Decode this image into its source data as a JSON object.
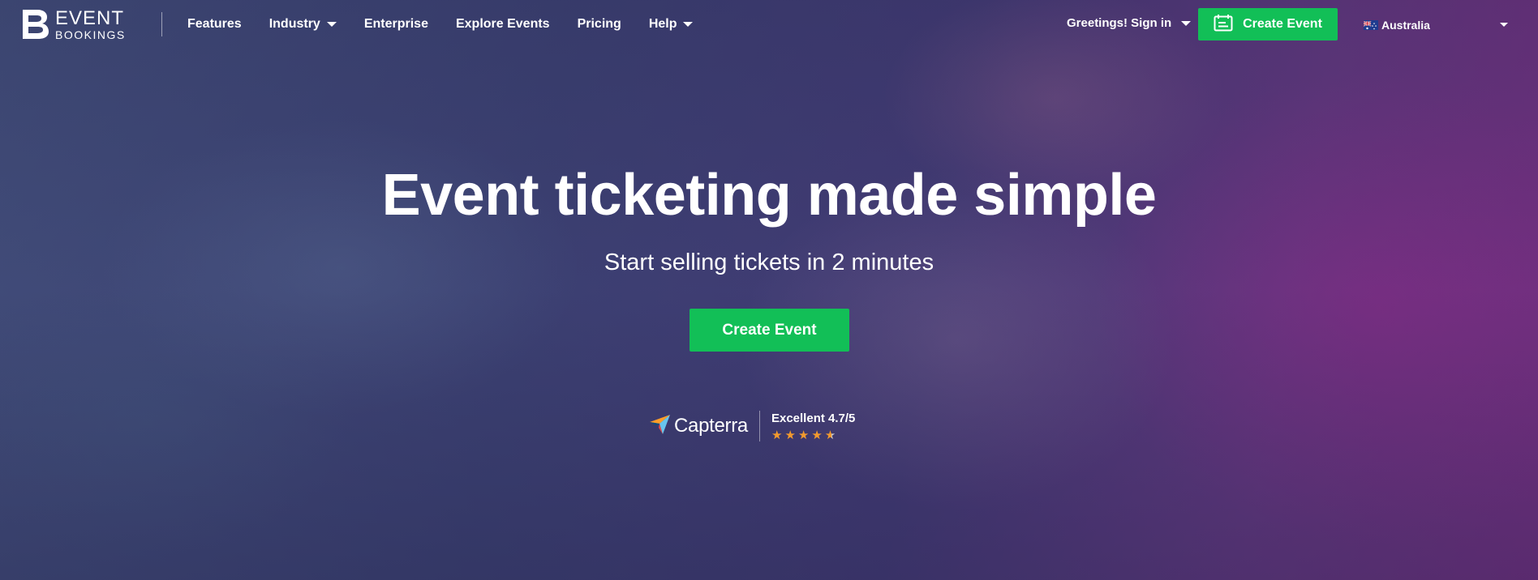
{
  "nav": {
    "logo": {
      "line1": "EVENT",
      "line2": "BOOKINGS"
    },
    "links": [
      {
        "label": "Features",
        "dropdown": false
      },
      {
        "label": "Industry",
        "dropdown": true
      },
      {
        "label": "Enterprise",
        "dropdown": false
      },
      {
        "label": "Explore Events",
        "dropdown": false
      },
      {
        "label": "Pricing",
        "dropdown": false
      },
      {
        "label": "Help",
        "dropdown": true
      }
    ],
    "signin_label": "Greetings! Sign in",
    "create_event_label": "Create Event",
    "country": "Australia"
  },
  "hero": {
    "title": "Event ticketing made simple",
    "subtitle": "Start selling tickets in 2 minutes",
    "cta_label": "Create Event"
  },
  "rating": {
    "brand": "Capterra",
    "text": "Excellent 4.7/5",
    "score": 4.7,
    "max": 5
  },
  "colors": {
    "accent_green": "#12bf57",
    "star": "#f29a2e"
  },
  "icons": [
    "event-bookings-logo",
    "chevron-down-icon",
    "calendar-icon",
    "australia-flag-icon",
    "capterra-logo",
    "star-icon"
  ]
}
